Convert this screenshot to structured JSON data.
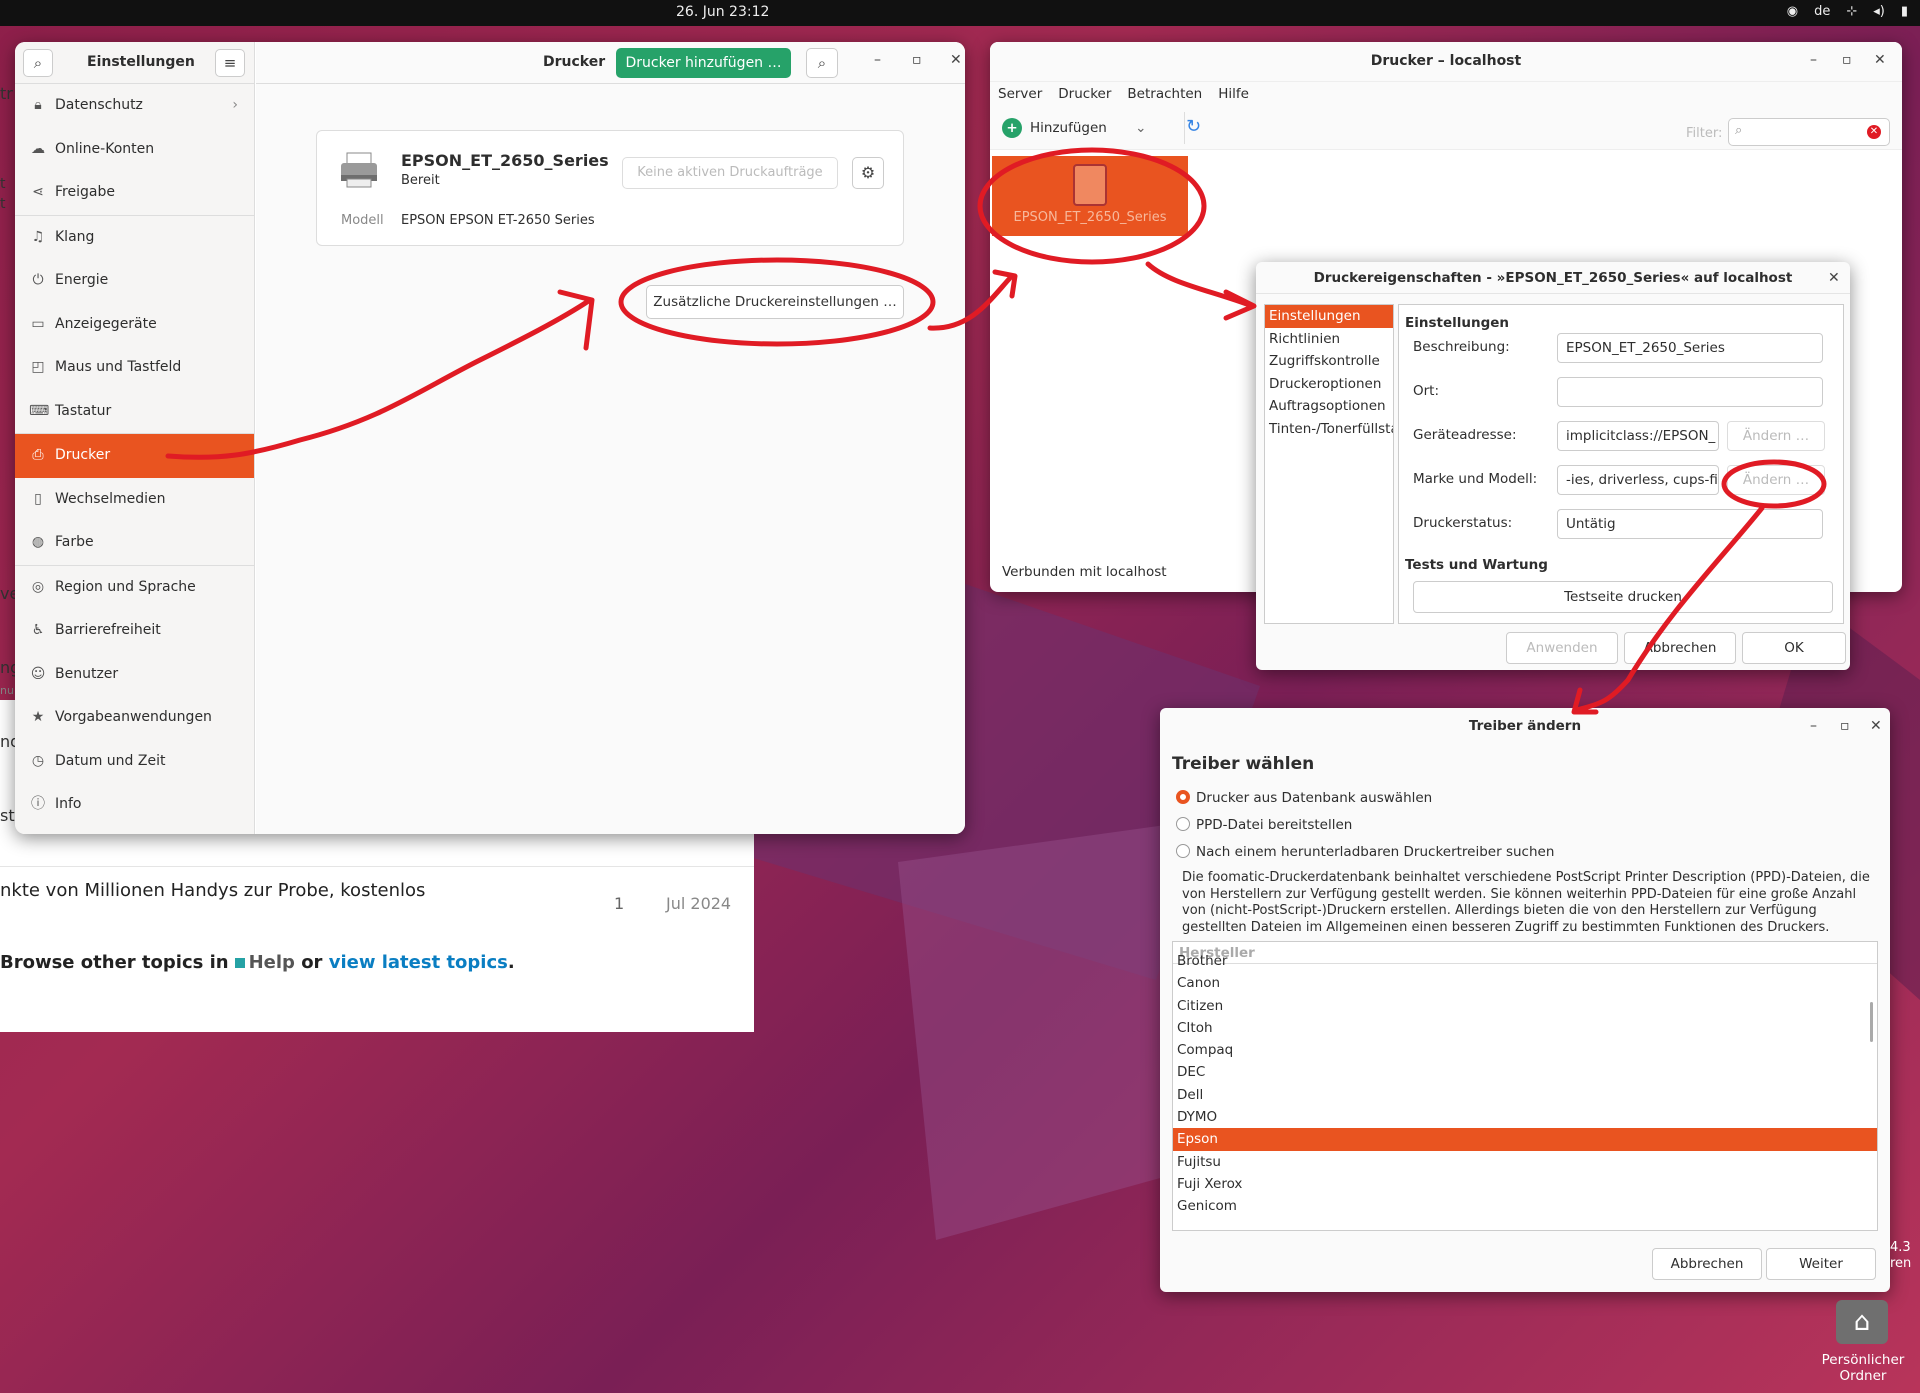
{
  "topbar": {
    "clock": "26. Jun  23:12",
    "lang": "de",
    "tray_icons": [
      "accessibility-icon",
      "network-icon",
      "volume-icon",
      "battery-icon"
    ]
  },
  "browser": {
    "fragments": [
      "tr",
      "t",
      "t",
      "ve",
      "ng",
      "nur",
      "nd",
      "sta"
    ],
    "row1_text": "nkte von Millionen Handys zur Probe, kostenlos",
    "row1_count": "1",
    "row1_date": "Jul 2024",
    "browse_prefix": "Browse other topics in",
    "browse_cat": "Help",
    "browse_or": "or",
    "browse_link": "view latest topics",
    "browse_end": "."
  },
  "settings": {
    "title": "Einstellungen",
    "items": [
      {
        "label": "Datenschutz",
        "icon": "lock-icon"
      },
      {
        "label": "Online-Konten",
        "icon": "cloud-icon"
      },
      {
        "label": "Freigabe",
        "icon": "share-icon"
      },
      {
        "label": "Klang",
        "icon": "music-note-icon"
      },
      {
        "label": "Energie",
        "icon": "power-icon"
      },
      {
        "label": "Anzeigegeräte",
        "icon": "display-icon"
      },
      {
        "label": "Maus und Tastfeld",
        "icon": "mouse-icon"
      },
      {
        "label": "Tastatur",
        "icon": "keyboard-icon"
      },
      {
        "label": "Drucker",
        "icon": "printer-icon"
      },
      {
        "label": "Wechselmedien",
        "icon": "usb-icon"
      },
      {
        "label": "Farbe",
        "icon": "palette-icon"
      },
      {
        "label": "Region und Sprache",
        "icon": "globe-icon"
      },
      {
        "label": "Barrierefreiheit",
        "icon": "accessibility-icon"
      },
      {
        "label": "Benutzer",
        "icon": "user-icon"
      },
      {
        "label": "Vorgabeanwendungen",
        "icon": "star-icon"
      },
      {
        "label": "Datum und Zeit",
        "icon": "clock-icon"
      },
      {
        "label": "Info",
        "icon": "info-icon"
      }
    ],
    "selected": "Drucker",
    "main_title": "Drucker",
    "add_button": "Drucker hinzufügen …",
    "printer": {
      "name": "EPSON_ET_2650_Series",
      "status": "Bereit",
      "model_label": "Modell",
      "model": "EPSON EPSON ET-2650 Series",
      "jobs": "Keine aktiven Druckaufträge"
    },
    "more_button": "Zusätzliche Druckereinstellungen …"
  },
  "printers_window": {
    "title": "Drucker – localhost",
    "menu": [
      "Server",
      "Drucker",
      "Betrachten",
      "Hilfe"
    ],
    "add": "Hinzufügen",
    "filter_label": "Filter:",
    "tile_label": "EPSON_ET_2650_Series",
    "status": "Verbunden mit localhost"
  },
  "props": {
    "title": "Druckereigenschaften - »EPSON_ET_2650_Series« auf localhost",
    "nav": [
      "Einstellungen",
      "Richtlinien",
      "Zugriffskontrolle",
      "Druckeroptionen",
      "Auftragsoptionen",
      "Tinten-/Tonerfüllsta"
    ],
    "section1": "Einstellungen",
    "fields": {
      "desc_label": "Beschreibung:",
      "desc_value": "EPSON_ET_2650_Series",
      "loc_label": "Ort:",
      "loc_value": "",
      "addr_label": "Geräteadresse:",
      "addr_value": "implicitclass://EPSON_",
      "make_label": "Marke und Modell:",
      "make_value": "-ies, driverless, cups-fil",
      "state_label": "Druckerstatus:",
      "state_value": "Untätig"
    },
    "change_btn": "Ändern …",
    "section2": "Tests und Wartung",
    "test_btn": "Testseite drucken",
    "apply": "Anwenden",
    "cancel": "Abbrechen",
    "ok": "OK"
  },
  "driver": {
    "title": "Treiber ändern",
    "heading": "Treiber wählen",
    "options": [
      "Drucker aus Datenbank auswählen",
      "PPD-Datei bereitstellen",
      "Nach einem herunterladbaren Druckertreiber suchen"
    ],
    "description": "Die foomatic-Druckerdatenbank beinhaltet verschiedene PostScript Printer Description (PPD)-Dateien, die von Herstellern zur Verfügung gestellt werden. Sie können weiterhin PPD-Dateien für eine große Anzahl von (nicht-PostScript-)Druckern erstellen. Allerdings bieten die von den Herstellern zur Verfügung gestellten Dateien im Allgemeinen einen besseren Zugriff zu bestimmten Funktionen des Druckers.",
    "list_header": "Hersteller",
    "vendors": [
      "Brother",
      "Canon",
      "Citizen",
      "CItoh",
      "Compaq",
      "DEC",
      "Dell",
      "DYMO",
      "Epson",
      "Fujitsu",
      "Fuji Xerox",
      "Genicom"
    ],
    "selected": "Epson",
    "cancel": "Abbrechen",
    "next": "Weiter"
  },
  "desktop": {
    "home_label": "Persönlicher Ordner",
    "frag1": "4.3",
    "frag2": "ren"
  },
  "colors": {
    "accent": "#e95420",
    "green": "#26a269",
    "annotation": "#e01b24"
  }
}
